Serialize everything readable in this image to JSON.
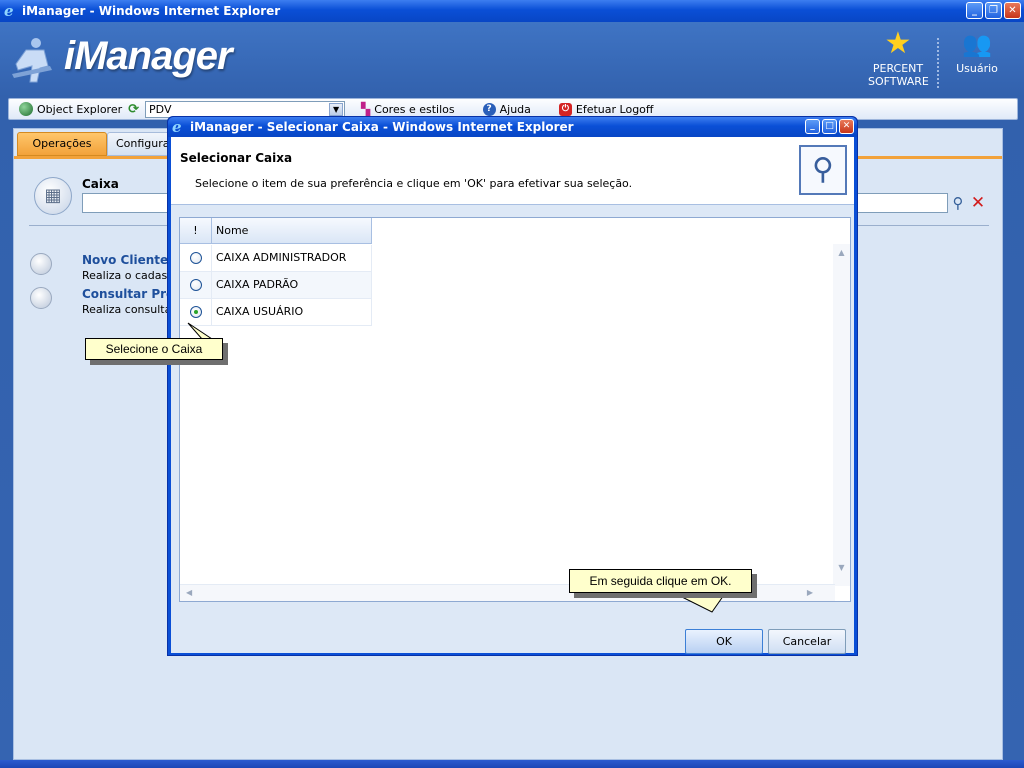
{
  "window": {
    "title": "iManager - Windows Internet Explorer"
  },
  "header": {
    "logo_text": "iManager",
    "percent_software": "PERCENT SOFTWARE",
    "user": "Usuário"
  },
  "toolbar": {
    "object_explorer": "Object Explorer",
    "select_value": "PDV",
    "cores": "Cores e estilos",
    "ajuda": "Ajuda",
    "logoff": "Efetuar Logoff"
  },
  "tabs": {
    "operacoes": "Operações",
    "configuracoes": "Configurações"
  },
  "main": {
    "caixa_label": "Caixa",
    "options": [
      {
        "title": "Novo Cliente",
        "desc": "Realiza o cadastro"
      },
      {
        "title": "Consultar Preço",
        "desc": "Realiza consulta d"
      }
    ]
  },
  "dialog": {
    "title": "iManager - Selecionar Caixa - Windows Internet Explorer",
    "heading": "Selecionar Caixa",
    "subtitle": "Selecione o item de sua preferência e clique em 'OK' para efetivar sua seleção.",
    "grid": {
      "col_flag": "!",
      "col_name": "Nome",
      "rows": [
        {
          "name": "CAIXA ADMINISTRADOR",
          "selected": false
        },
        {
          "name": "CAIXA PADRÃO",
          "selected": false
        },
        {
          "name": "CAIXA USUÁRIO",
          "selected": true
        }
      ]
    },
    "ok": "OK",
    "cancel": "Cancelar"
  },
  "callouts": {
    "select": "Selecione o Caixa",
    "ok_hint": "Em seguida clique em OK."
  },
  "colors": {
    "title_blue": "#0a4fd6",
    "tab_orange": "#f2a23a",
    "callout_bg": "#ffffcc"
  }
}
